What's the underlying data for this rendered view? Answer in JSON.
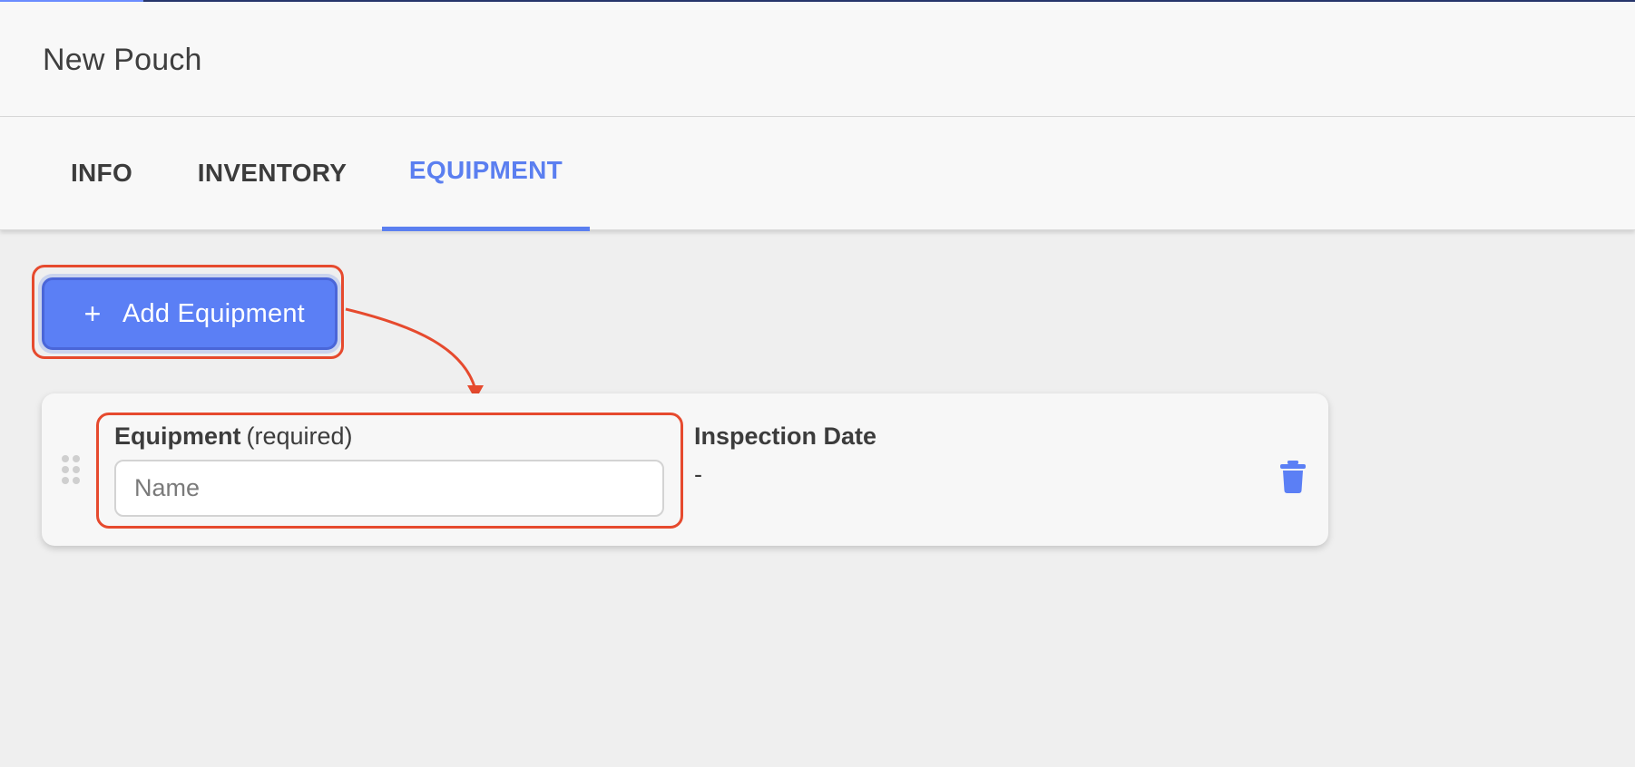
{
  "header": {
    "title": "New Pouch"
  },
  "tabs": [
    {
      "label": "INFO",
      "active": false
    },
    {
      "label": "INVENTORY",
      "active": false
    },
    {
      "label": "EQUIPMENT",
      "active": true
    }
  ],
  "toolbar": {
    "add_label": "Add Equipment",
    "add_icon": "plus-icon"
  },
  "equipment_row": {
    "equipment_label": "Equipment",
    "equipment_qualifier": "(required)",
    "name_placeholder": "Name",
    "name_value": "",
    "inspection_label": "Inspection Date",
    "inspection_value": "-",
    "delete_icon": "trash-icon",
    "drag_icon": "drag-handle-icon"
  },
  "colors": {
    "accent": "#5b7ff5",
    "annotation": "#e64a2e",
    "header_strip": "#26356b"
  }
}
